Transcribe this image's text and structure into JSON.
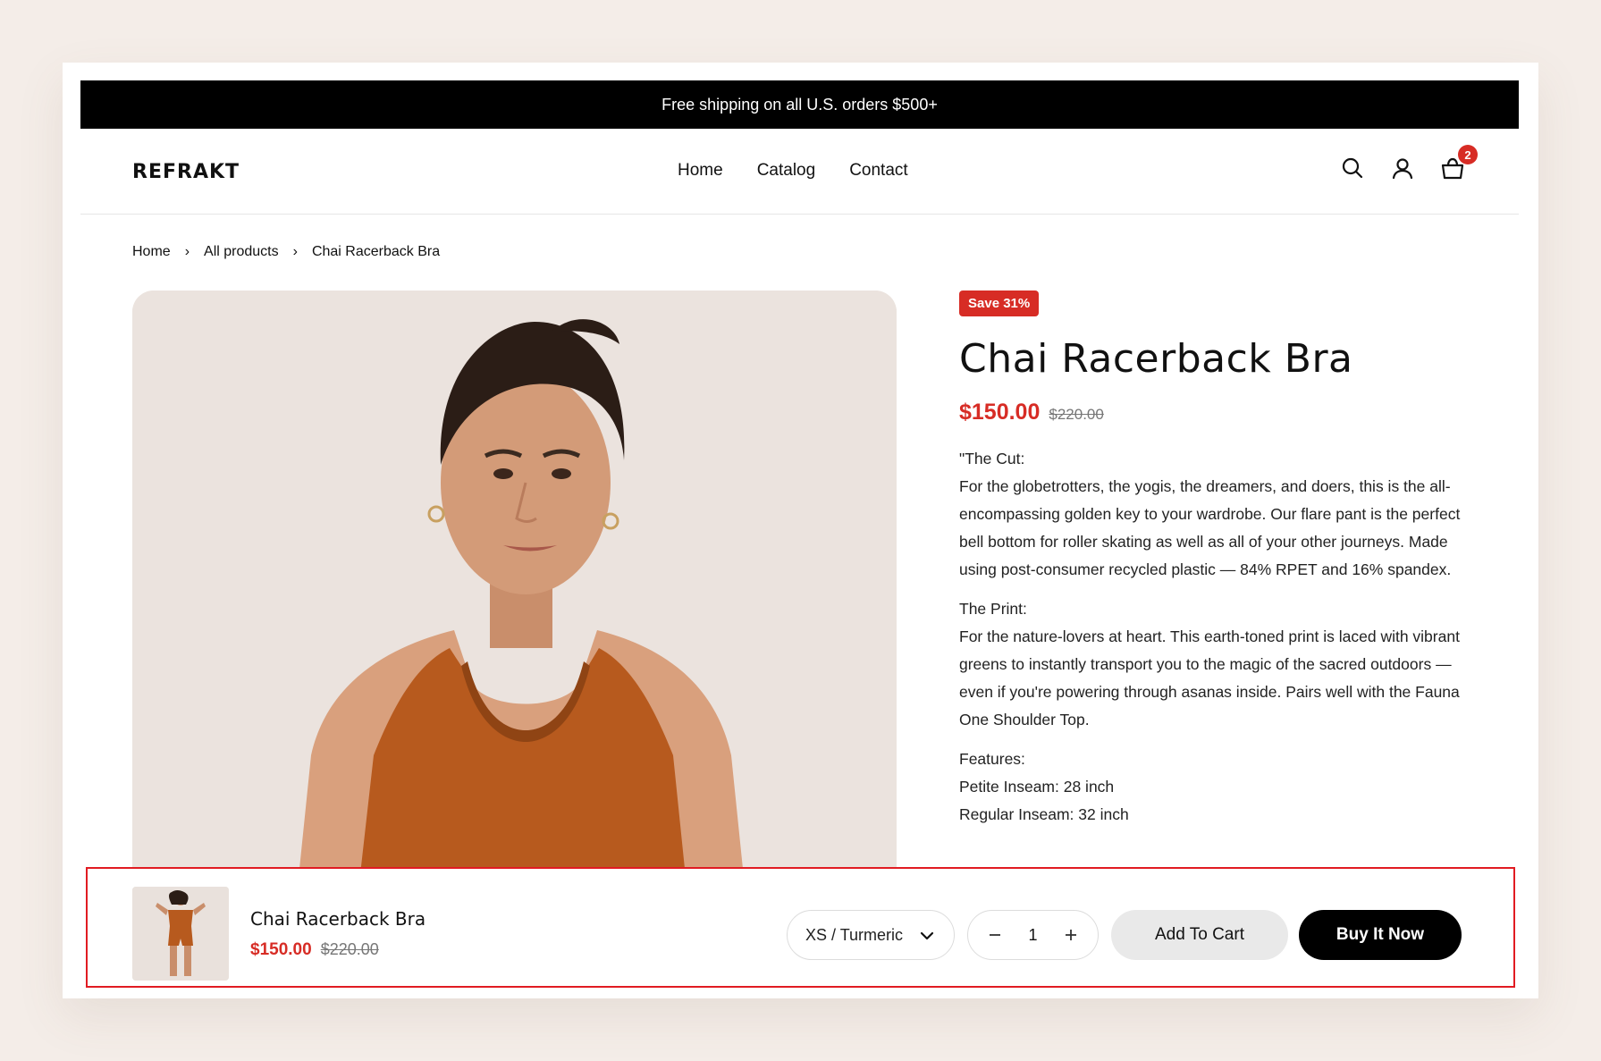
{
  "announcement": {
    "text": "Free shipping on all U.S. orders $500+"
  },
  "header": {
    "logo": "REFRAKT",
    "nav": [
      "Home",
      "Catalog",
      "Contact"
    ],
    "cart_count": "2",
    "icons": [
      "search-icon",
      "account-icon",
      "cart-icon"
    ]
  },
  "breadcrumb": [
    "Home",
    "All products",
    "Chai Racerback Bra"
  ],
  "product": {
    "badge": "Save 31%",
    "title": "Chai Racerback Bra",
    "price": "$150.00",
    "compare_price": "$220.00",
    "description": {
      "cut_heading": "\"The Cut:",
      "cut_text": "For the globetrotters, the yogis, the dreamers, and doers, this is the all-encompassing golden key to your wardrobe. Our flare pant is the perfect bell bottom for roller skating as well as all of your other journeys. Made using post-consumer recycled plastic — 84% RPET and 16% spandex.",
      "print_heading": "The Print:",
      "print_text": "For the nature-lovers at heart. This earth-toned print is laced with vibrant greens to instantly transport you to the magic of the sacred outdoors — even if you're powering through asanas inside. Pairs well with the Fauna One Shoulder Top.",
      "features_heading": "Features:",
      "features": [
        "Petite Inseam: 28 inch",
        "Regular Inseam: 32 inch"
      ]
    }
  },
  "sticky_bar": {
    "title": "Chai Racerback Bra",
    "price": "$150.00",
    "compare_price": "$220.00",
    "variant": "XS / Turmeric",
    "quantity": "1",
    "add_to_cart": "Add To Cart",
    "buy_now": "Buy It Now"
  },
  "colors": {
    "accent_red": "#d72c25",
    "highlight_border": "#e11b22",
    "top_fabric": "#b75a1e",
    "page_bg": "#f4ede8"
  }
}
